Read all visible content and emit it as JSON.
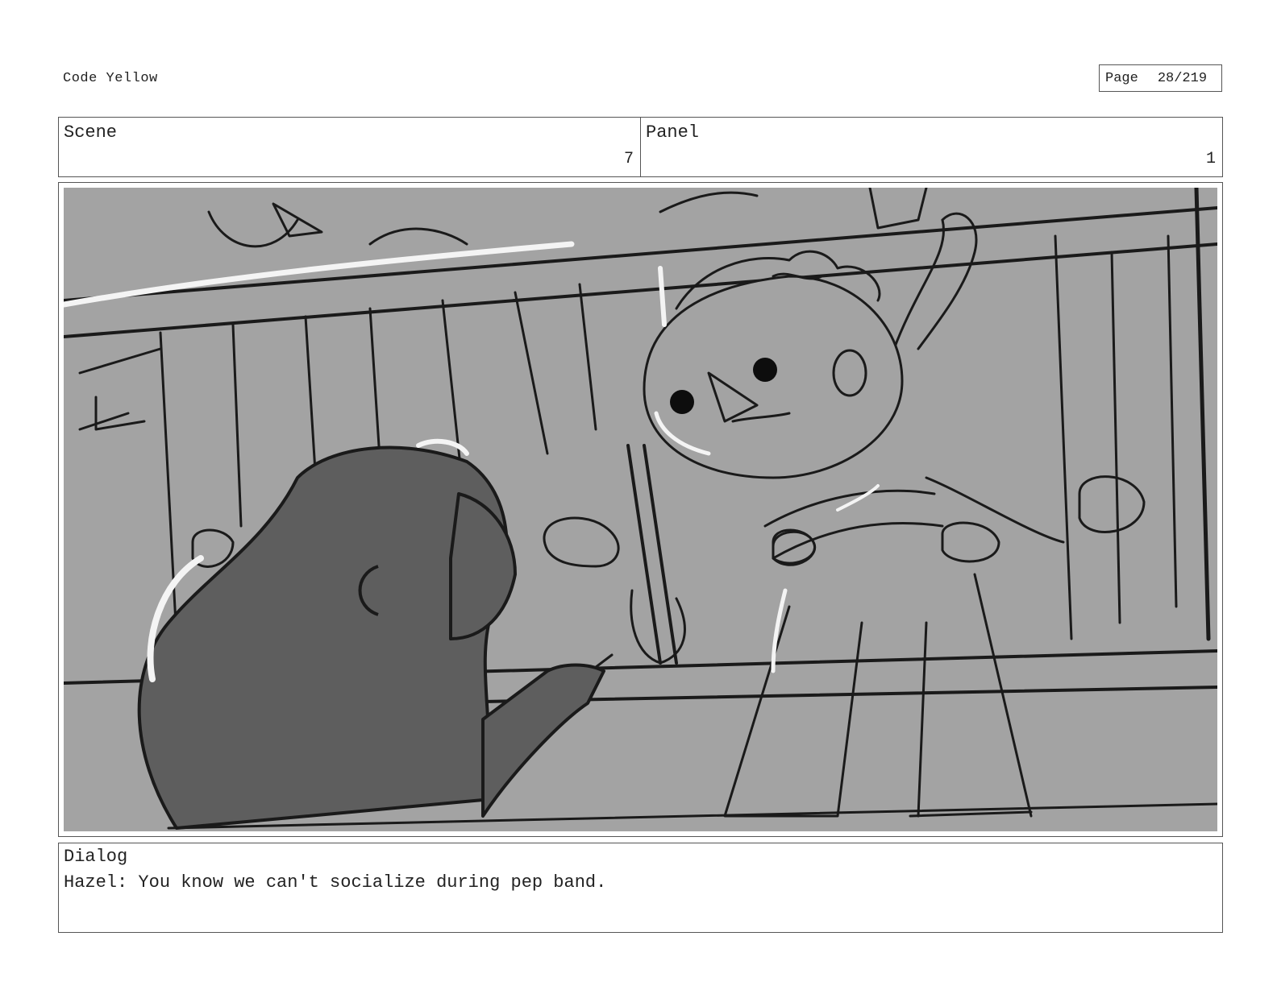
{
  "document": {
    "project_title": "Code Yellow",
    "page_label": "Page",
    "page_number": "28/219"
  },
  "header": {
    "scene_label": "Scene",
    "scene_number": "7",
    "panel_label": "Panel",
    "panel_number": "1"
  },
  "frame": {
    "background_color": "#a3a3a3",
    "line_color": "#1a1a1a"
  },
  "dialog": {
    "label": "Dialog",
    "text": "Hazel: You know we can't socialize during pep band."
  }
}
